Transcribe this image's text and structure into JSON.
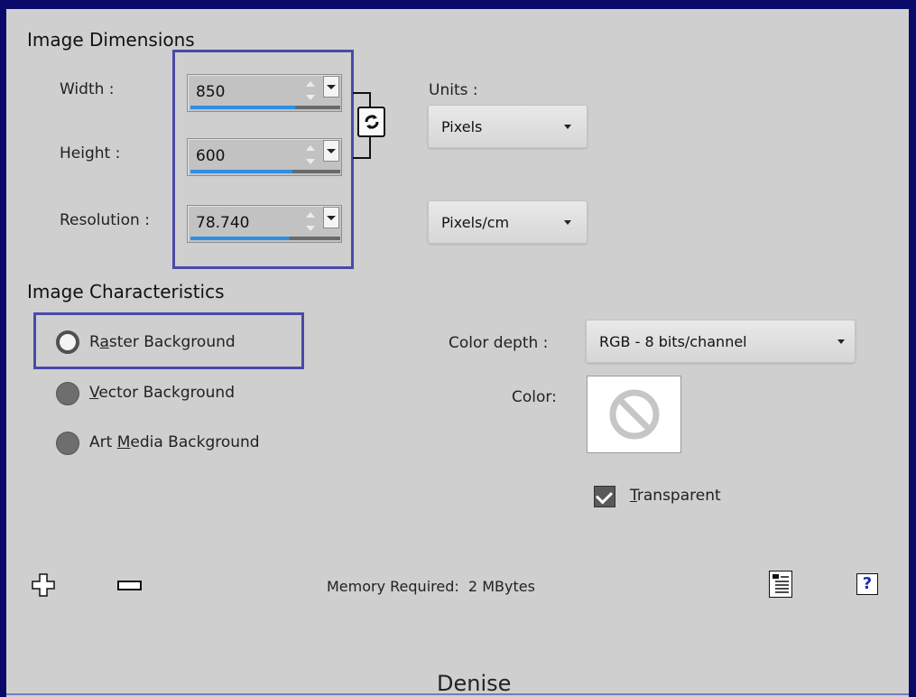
{
  "image_dimensions": {
    "title": "Image Dimensions",
    "width": {
      "label": "Width :",
      "value": "850"
    },
    "height": {
      "label": "Height :",
      "value": "600"
    },
    "resolution": {
      "label": "Resolution :",
      "value": "78.740"
    },
    "units_label": "Units :",
    "units_value": "Pixels",
    "resolution_units_value": "Pixels/cm",
    "link_icon": "aspect-link-icon"
  },
  "image_characteristics": {
    "title": "Image Characteristics",
    "options": [
      {
        "pre": "R",
        "accel": "a",
        "post": "ster Background",
        "selected": true
      },
      {
        "pre": "",
        "accel": "V",
        "post": "ector Background",
        "selected": false
      },
      {
        "pre": "Art ",
        "accel": "M",
        "post": "edia Background",
        "selected": false
      }
    ],
    "color_depth_label": "Color depth :",
    "color_depth_value": "RGB - 8 bits/channel",
    "color_label": "Color:",
    "transparent_accel": "T",
    "transparent_rest": "ransparent",
    "transparent_checked": true
  },
  "footer": {
    "memory_text": "Memory Required:  2 MBytes",
    "add_icon": "plus-icon",
    "remove_icon": "minus-icon",
    "presets_icon": "presets-icon",
    "help_icon": "help-icon",
    "help_glyph": "?",
    "watermark": "Denise"
  },
  "colors": {
    "frame_border": "#0a0a6b",
    "highlight_border": "#4a4aa8",
    "slider_fill": "#2f8fe0",
    "dialog_background": "#cfcfcf"
  },
  "slider_levels": {
    "width": 0.7,
    "height": 0.68,
    "resolution": 0.66
  }
}
